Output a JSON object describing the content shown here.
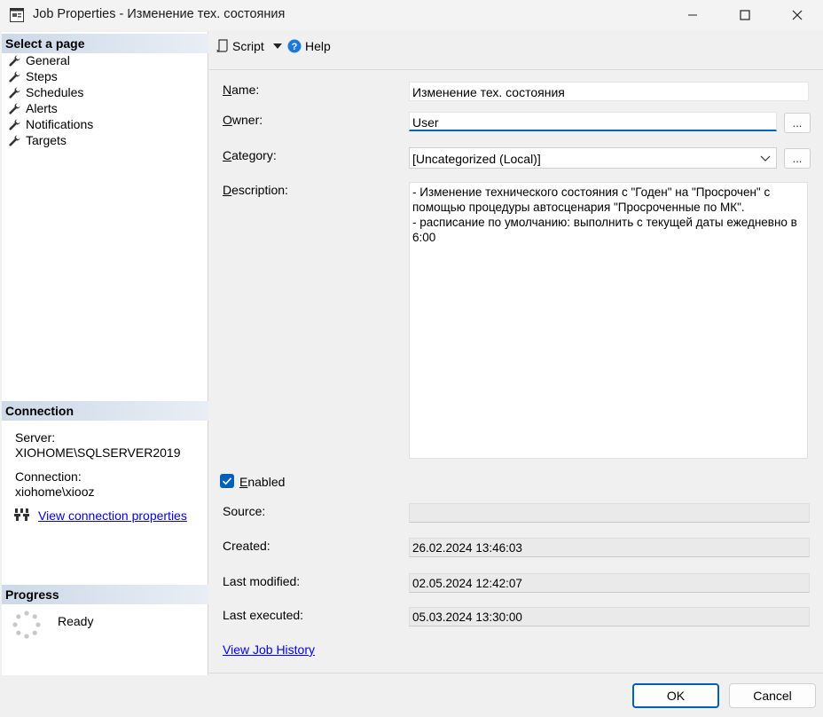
{
  "window": {
    "title": "Job Properties - Изменение тех. состояния"
  },
  "left_panel": {
    "select_page_header": "Select a page",
    "pages": [
      {
        "label": "General",
        "icon": "wrench-icon"
      },
      {
        "label": "Steps",
        "icon": "wrench-icon"
      },
      {
        "label": "Schedules",
        "icon": "wrench-icon"
      },
      {
        "label": "Alerts",
        "icon": "wrench-icon"
      },
      {
        "label": "Notifications",
        "icon": "wrench-icon"
      },
      {
        "label": "Targets",
        "icon": "wrench-icon"
      }
    ],
    "connection_header": "Connection",
    "server_label": "Server:",
    "server_value": "XIOHOME\\SQLSERVER2019",
    "connection_label": "Connection:",
    "connection_value": "xiohome\\xiooz",
    "view_connection_link": "View connection properties",
    "progress_header": "Progress",
    "progress_status": "Ready"
  },
  "toolbar": {
    "script_label": "Script",
    "help_label": "Help"
  },
  "form": {
    "name_label_hotkey": "N",
    "name_label_rest": "ame:",
    "name_value": "Изменение тех. состояния",
    "owner_label_hotkey": "O",
    "owner_label_rest": "wner:",
    "owner_value": "User",
    "category_label_hotkey": "C",
    "category_label_rest": "ategory:",
    "category_value": "[Uncategorized (Local)]",
    "description_label_hotkey": "D",
    "description_label_rest": "escription:",
    "description_value": "- Изменение технического состояния с \"Годен\" на \"Просрочен\" с помощью процедуры автосценария \"Просроченные по МК\".\n- расписание по умолчанию: выполнить с текущей даты ежедневно в 6:00",
    "ellipsis_label": "...",
    "enabled_label_hotkey": "E",
    "enabled_label_rest": "nabled",
    "enabled_checked": true,
    "source_label": "Source:",
    "source_value": "",
    "created_label": "Created:",
    "created_value": "26.02.2024 13:46:03",
    "last_modified_label": "Last modified:",
    "last_modified_value": "02.05.2024 12:42:07",
    "last_executed_label": "Last executed:",
    "last_executed_value": "05.03.2024 13:30:00",
    "view_history_link": "View Job History"
  },
  "buttons": {
    "ok": "OK",
    "cancel": "Cancel"
  },
  "colors": {
    "accent": "#005fb8",
    "link": "#0000ee"
  }
}
